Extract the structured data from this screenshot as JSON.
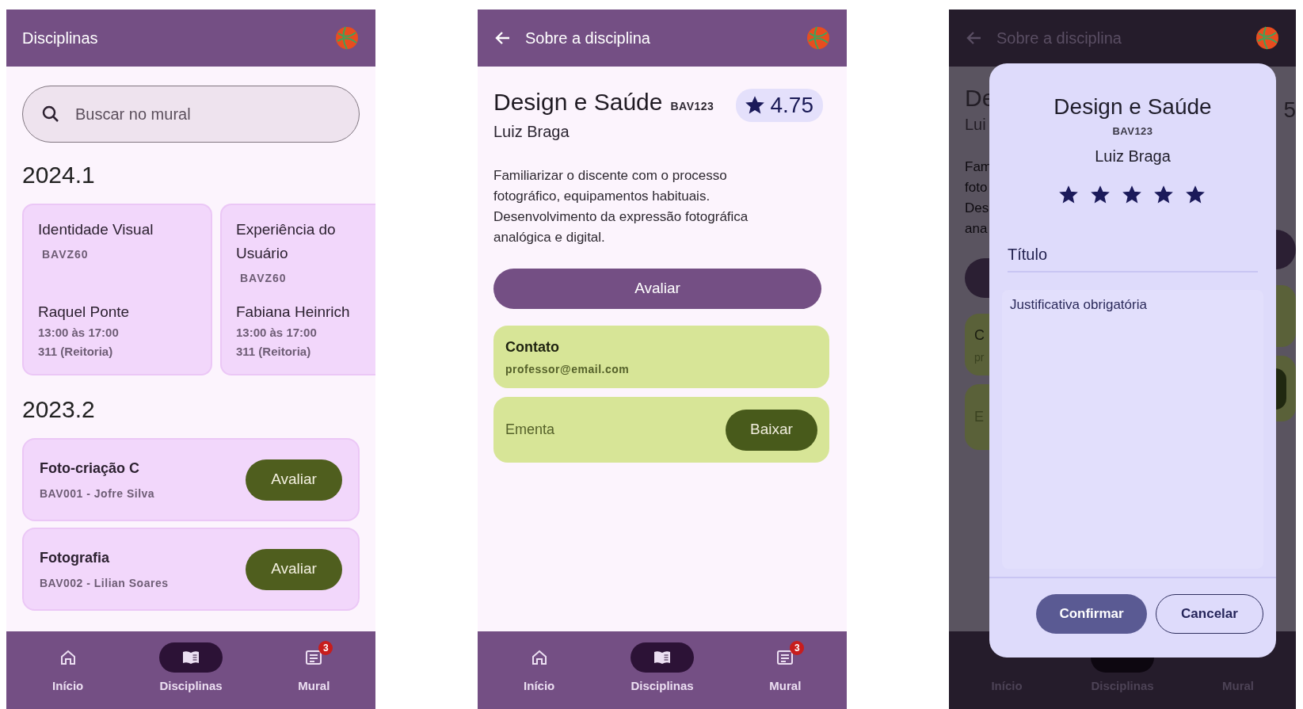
{
  "list_screen": {
    "app_bar": {
      "title": "Disciplinas"
    },
    "search": {
      "placeholder": "Buscar no mural"
    },
    "current_term": {
      "label": "2024.1",
      "courses": [
        {
          "name": "Identidade Visual",
          "code": "BAVZ60",
          "professor": "Raquel Ponte",
          "time": "13:00 às 17:00",
          "room": "311 (Reitoria)"
        },
        {
          "name": "Experiência do Usuário",
          "code": "BAVZ60",
          "professor": "Fabiana Heinrich",
          "time": "13:00 às 17:00",
          "room": "311 (Reitoria)"
        }
      ]
    },
    "past_term": {
      "label": "2023.2",
      "courses": [
        {
          "name": "Foto-criação C",
          "subtitle": "BAV001 - Jofre Silva",
          "button": "Avaliar"
        },
        {
          "name": "Fotografia",
          "subtitle": "BAV002 - Lilian Soares",
          "button": "Avaliar"
        }
      ]
    },
    "nav": [
      {
        "label": "Início",
        "selected": false
      },
      {
        "label": "Disciplinas",
        "selected": true
      },
      {
        "label": "Mural",
        "selected": false,
        "badge": "3"
      }
    ]
  },
  "detail_screen": {
    "app_bar": {
      "title": "Sobre a disciplina"
    },
    "course": {
      "name": "Design e Saúde",
      "code": "BAV123",
      "professor": "Luiz Braga",
      "rating": "4.75",
      "description": "Familiarizar o discente com o processo fotográfico, equipamentos habituais. Desenvolvimento da expressão fotográfica analógica e digital.",
      "button": "Avaliar"
    },
    "contact": {
      "label": "Contato",
      "value": "professor@email.com"
    },
    "syllabus": {
      "label": "Ementa",
      "button": "Baixar"
    },
    "nav": [
      {
        "label": "Início",
        "selected": false
      },
      {
        "label": "Disciplinas",
        "selected": true
      },
      {
        "label": "Mural",
        "selected": false,
        "badge": "3"
      }
    ]
  },
  "rating_screen": {
    "backdrop": {
      "app_bar_title": "Sobre a disciplina",
      "title": "De",
      "professor": "Lui",
      "description_lines": [
        "Fam",
        "foto",
        "Des",
        "ana"
      ],
      "contact_title": "C",
      "contact_value": "pr",
      "syllabus_label": "E",
      "rating": "5",
      "nav": [
        {
          "label": "Início",
          "selected": false
        },
        {
          "label": "Disciplinas",
          "selected": true
        },
        {
          "label": "Mural",
          "selected": false
        }
      ]
    },
    "dialog": {
      "title": "Design e Saúde",
      "code": "BAV123",
      "professor": "Luiz Braga",
      "stars": 5,
      "title_field": {
        "placeholder": "Título"
      },
      "justification_field": {
        "placeholder": "Justificativa obrigatória"
      },
      "confirm": "Confirmar",
      "cancel": "Cancelar"
    }
  }
}
